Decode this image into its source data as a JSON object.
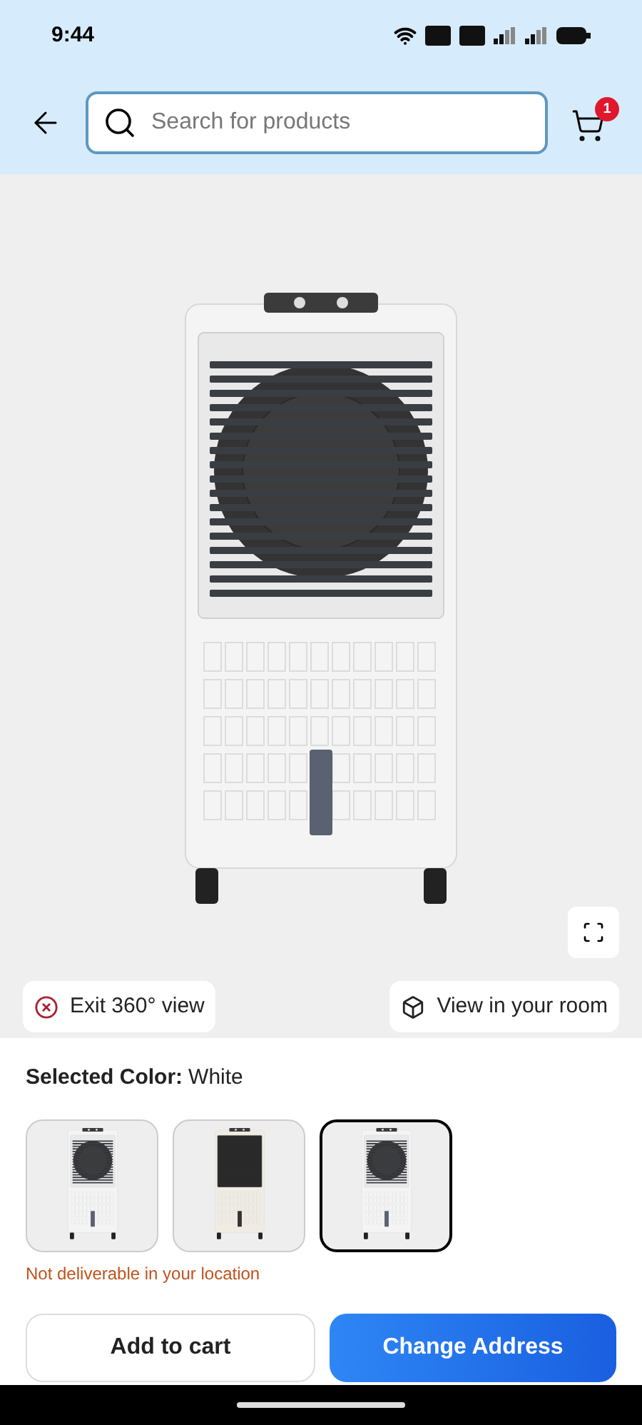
{
  "status_bar": {
    "time": "9:44"
  },
  "header": {
    "search": {
      "placeholder": "Search for products"
    },
    "cart_count": "1"
  },
  "viewer": {
    "exit_label": "Exit 360° view",
    "room_label": "View in your room"
  },
  "color_picker": {
    "label": "Selected Color:",
    "value": "White",
    "swatches": [
      {
        "kind": "white",
        "selected": false
      },
      {
        "kind": "dark",
        "selected": false
      },
      {
        "kind": "white",
        "selected": true
      }
    ],
    "notice": "Not deliverable in your location"
  },
  "actions": [
    {
      "kind": "secondary",
      "label": "Add to cart"
    },
    {
      "kind": "primary",
      "label": "Change Address"
    }
  ]
}
